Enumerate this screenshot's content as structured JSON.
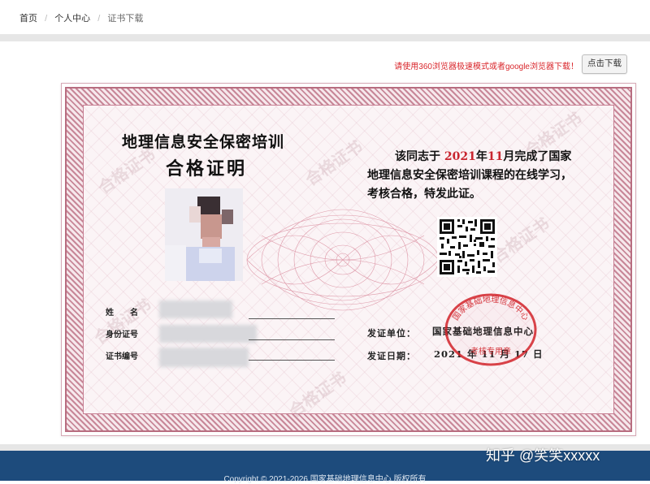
{
  "breadcrumb": {
    "items": [
      "首页",
      "个人中心",
      "证书下载"
    ],
    "separator": "/"
  },
  "notice": {
    "text": "请使用360浏览器极速模式或者google浏览器下载！",
    "color": "#d9262b"
  },
  "download_button": {
    "label": "点击下载"
  },
  "certificate": {
    "title_line1": "地理信息安全保密培训",
    "title_line2": "合格证明",
    "body": {
      "p1": "该同志于",
      "year": "2021",
      "p2": "年",
      "month": "11",
      "p3": "月完成了国家地理信息安全保密培训课程的在线学习，考核合格，特发此证。"
    },
    "fields": {
      "name_label": "姓　　名",
      "id_label": "身份证号",
      "cert_no_label": "证书编号"
    },
    "issuer": {
      "label": "发证单位：",
      "value": "国家基础地理信息中心"
    },
    "issue_date": {
      "label": "发证日期：",
      "value": "2021 年 11 月 17 日"
    },
    "seal": {
      "outer_text": "国家基础地理信息中心",
      "inner_text": "考核专用章",
      "color": "#d2232a"
    },
    "watermark": "合格证书",
    "colors": {
      "border": "#b86d80",
      "paper": "#fbf4f6"
    }
  },
  "footer": {
    "copyright": "Copyright © 2021-2026 国家基础地理信息中心 版权所有",
    "background": "#1d4b7c"
  },
  "overlay_watermark": "知乎 @笑笑xxxxx"
}
